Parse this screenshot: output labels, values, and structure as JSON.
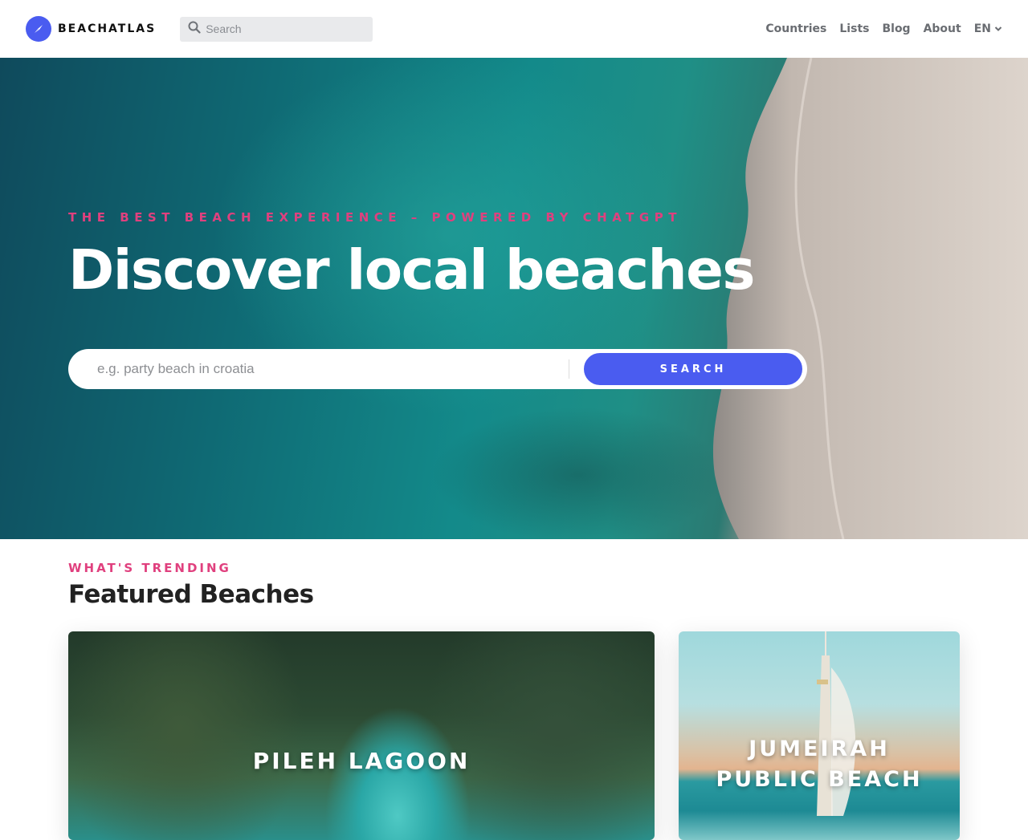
{
  "header": {
    "brand": "BEACHATLAS",
    "search_placeholder": "Search",
    "nav": {
      "countries": "Countries",
      "lists": "Lists",
      "blog": "Blog",
      "about": "About",
      "language": "EN"
    }
  },
  "hero": {
    "tagline": "THE BEST BEACH EXPERIENCE – POWERED BY CHATGPT",
    "title": "Discover local beaches",
    "search_placeholder": "e.g. party beach in croatia",
    "search_button": "SEARCH"
  },
  "featured": {
    "tag": "WHAT'S TRENDING",
    "title": "Featured Beaches",
    "cards": [
      {
        "name": "PILEH LAGOON"
      },
      {
        "name": "JUMEIRAH PUBLIC BEACH"
      }
    ]
  },
  "colors": {
    "accent": "#4a5cf0",
    "pink": "#e0407e",
    "nav_text": "#6a6d72"
  }
}
